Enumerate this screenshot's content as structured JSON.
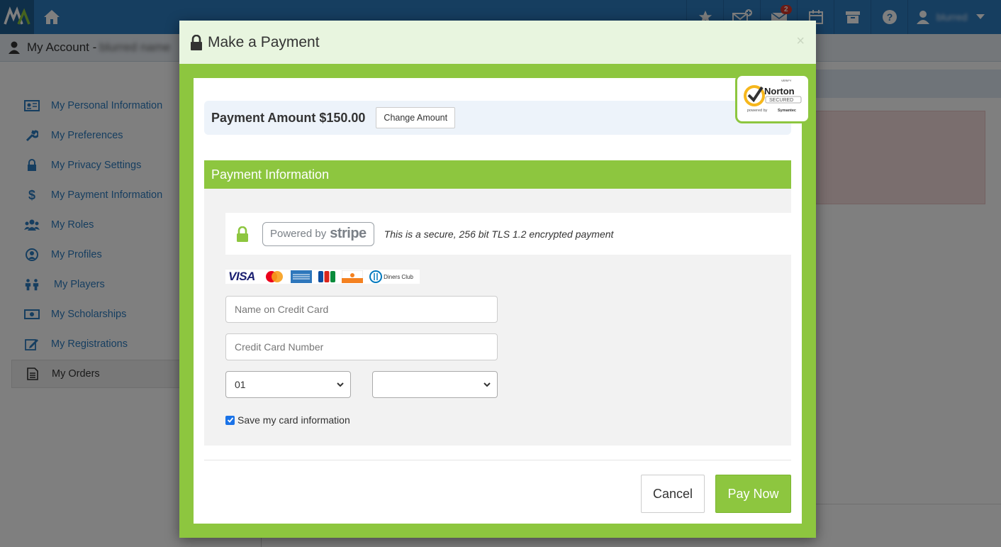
{
  "header": {
    "notifications_count": "2",
    "username": "blurred"
  },
  "account": {
    "title": "My Account -",
    "name": "blurred name"
  },
  "sidebar": {
    "items": [
      {
        "label": "My Personal Information",
        "icon": "id-card-icon"
      },
      {
        "label": "My Preferences",
        "icon": "wrench-icon"
      },
      {
        "label": "My Privacy Settings",
        "icon": "lock-icon"
      },
      {
        "label": "My Payment Information",
        "icon": "dollar-icon"
      },
      {
        "label": "My Roles",
        "icon": "users-icon"
      },
      {
        "label": "My Profiles",
        "icon": "user-circle-icon"
      },
      {
        "label": "My Players",
        "icon": "children-icon"
      },
      {
        "label": "My Scholarships",
        "icon": "money-icon"
      },
      {
        "label": "My Registrations",
        "icon": "edit-icon"
      },
      {
        "label": "My Orders",
        "icon": "document-icon"
      }
    ]
  },
  "modal": {
    "title": "Make a Payment",
    "close": "×",
    "amount_text": "Payment Amount $150.00",
    "change_amount_label": "Change Amount",
    "section_title": "Payment Information",
    "stripe_powered": "Powered by",
    "stripe_brand": "stripe",
    "secure_text": "This is a secure, 256 bit TLS 1.2 encrypted payment",
    "name_placeholder": "Name on Credit Card",
    "number_placeholder": "Credit Card Number",
    "month_value": "01",
    "year_value": "",
    "save_card_label": "Save my card information",
    "cancel_label": "Cancel",
    "pay_label": "Pay Now"
  },
  "norton": {
    "verify": "VERIFY",
    "brand": "Norton",
    "secured": "SECURED",
    "powered": "powered by",
    "symantec": "Symantec"
  },
  "cards": {
    "visa": "VISA",
    "diners": "Diners Club"
  },
  "colors": {
    "primary": "#2d7cc1",
    "green": "#8dc63f",
    "modal_header": "#e8f5df"
  }
}
